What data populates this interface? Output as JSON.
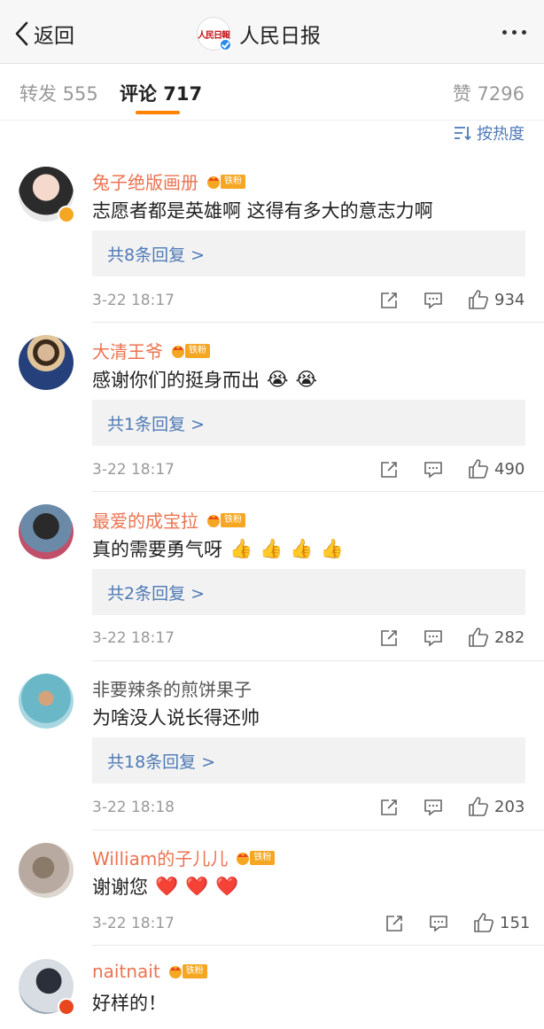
{
  "header": {
    "back_label": "返回",
    "title": "人民日报",
    "logo_text": "人民日報"
  },
  "tabs": {
    "repost": "转发 555",
    "comments": "评论 717",
    "likes": "赞 7296"
  },
  "sort_label": "按热度",
  "fan_badge_text": "铁粉",
  "colors": {
    "accent_orange": "#ff8200",
    "link_blue": "#4f7ab6",
    "username_orange": "#eb7350",
    "fan_badge": "#f5a623"
  },
  "comments": [
    {
      "username": "兔子绝版画册",
      "fan": true,
      "text": "志愿者都是英雄啊 这得有多大的意志力啊",
      "emojis": [],
      "reply_label": "共8条回复 >",
      "time": "3-22 18:17",
      "likes": "934",
      "verified": "yellow"
    },
    {
      "username": "大清王爷",
      "fan": true,
      "text": "感谢你们的挺身而出",
      "emojis": [
        "😭",
        "😭"
      ],
      "reply_label": "共1条回复 >",
      "time": "3-22 18:17",
      "likes": "490",
      "verified": ""
    },
    {
      "username": "最爱的成宝拉",
      "fan": true,
      "text": "真的需要勇气呀",
      "emojis": [
        "👍",
        "👍",
        "👍",
        "👍"
      ],
      "reply_label": "共2条回复 >",
      "time": "3-22 18:17",
      "likes": "282",
      "verified": ""
    },
    {
      "username": "非要辣条的煎饼果子",
      "fan": false,
      "text": "为啥没人说长得还帅",
      "emojis": [],
      "reply_label": "共18条回复 >",
      "time": "3-22 18:18",
      "likes": "203",
      "verified": ""
    },
    {
      "username": "William的子儿儿",
      "fan": true,
      "text": "谢谢您",
      "emojis": [
        "❤️",
        "❤️",
        "❤️"
      ],
      "reply_label": "",
      "time": "3-22 18:17",
      "likes": "151",
      "verified": ""
    },
    {
      "username": "naitnait",
      "fan": true,
      "text": "好样的！",
      "emojis": [],
      "reply_label": "",
      "time": "",
      "likes": "",
      "verified": "red"
    }
  ]
}
